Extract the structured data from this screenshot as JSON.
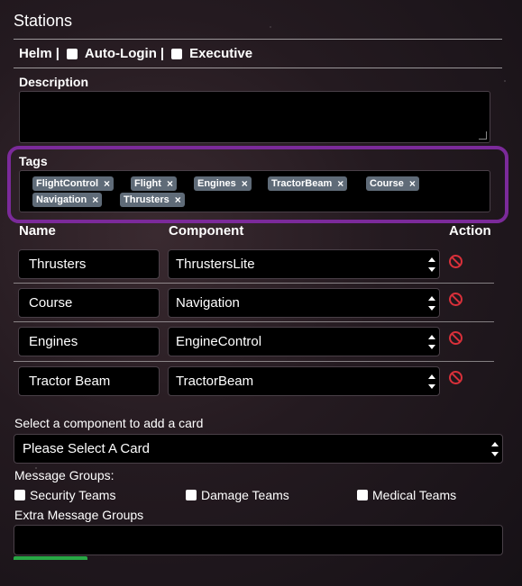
{
  "page_title": "Stations",
  "station": {
    "name": "Helm",
    "separator": "|",
    "auto_login_label": "Auto-Login",
    "executive_label": "Executive"
  },
  "description": {
    "label": "Description",
    "value": ""
  },
  "tags": {
    "label": "Tags",
    "items": [
      "FlightControl",
      "Flight",
      "Engines",
      "TractorBeam",
      "Course",
      "Navigation",
      "Thrusters"
    ],
    "remove_glyph": "×",
    "highlight_color": "#7b2a9a"
  },
  "cards": {
    "headers": {
      "name": "Name",
      "component": "Component",
      "action": "Action"
    },
    "rows": [
      {
        "name": "Thrusters",
        "component": "ThrustersLite"
      },
      {
        "name": "Course",
        "component": "Navigation"
      },
      {
        "name": "Engines",
        "component": "EngineControl"
      },
      {
        "name": "Tractor Beam",
        "component": "TractorBeam"
      }
    ],
    "remove_icon": "ban-icon"
  },
  "add_card": {
    "label": "Select a component to add a card",
    "selected": "Please Select A Card"
  },
  "message_groups": {
    "label": "Message Groups:",
    "options": [
      "Security Teams",
      "Damage Teams",
      "Medical Teams"
    ]
  },
  "extra_groups": {
    "label": "Extra Message Groups",
    "value": ""
  }
}
